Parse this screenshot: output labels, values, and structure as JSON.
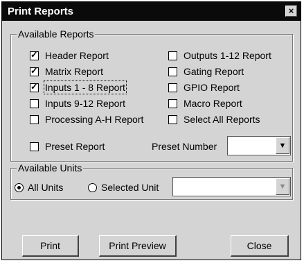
{
  "window": {
    "title": "Print Reports",
    "close_glyph": "×"
  },
  "reports": {
    "group_label": "Available Reports",
    "items": [
      {
        "label": "Header Report",
        "checked": true
      },
      {
        "label": "Matrix Report",
        "checked": true
      },
      {
        "label": "Inputs 1 - 8 Report",
        "checked": true
      },
      {
        "label": "Inputs 9-12 Report",
        "checked": false
      },
      {
        "label": "Processing A-H Report",
        "checked": false
      },
      {
        "label": "Outputs 1-12 Report",
        "checked": false
      },
      {
        "label": "Gating Report",
        "checked": false
      },
      {
        "label": "GPIO Report",
        "checked": false
      },
      {
        "label": "Macro Report",
        "checked": false
      },
      {
        "label": "Select All Reports",
        "checked": false
      },
      {
        "label": "Preset Report",
        "checked": false
      }
    ],
    "preset_number_label": "Preset Number",
    "preset_number_value": ""
  },
  "units": {
    "group_label": "Available Units",
    "all_units_label": "All Units",
    "selected_unit_label": "Selected Unit",
    "selected_option": "All Units",
    "unit_value": ""
  },
  "buttons": {
    "print": "Print",
    "print_preview": "Print Preview",
    "close": "Close"
  }
}
